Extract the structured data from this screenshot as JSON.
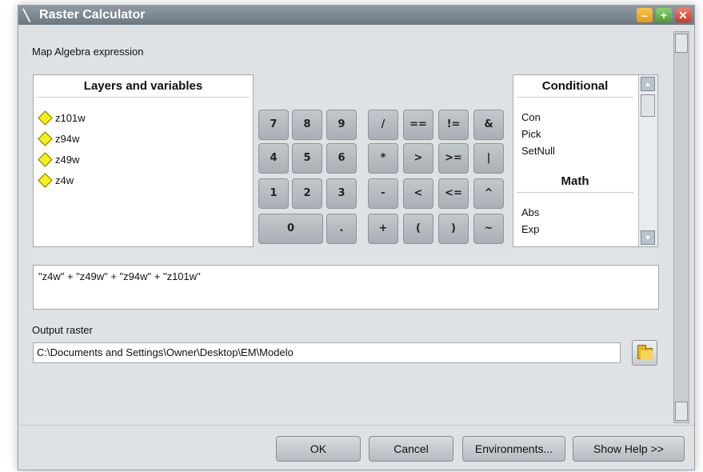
{
  "window": {
    "title": "Raster Calculator",
    "controls": {
      "minimize": "–",
      "maximize": "+",
      "close": "✕"
    },
    "icon": "raster-calculator-icon"
  },
  "expression_label": "Map Algebra expression",
  "layers": {
    "header": "Layers and variables",
    "items": [
      "z101w",
      "z94w",
      "z49w",
      "z4w"
    ]
  },
  "keypad": {
    "numbers": [
      "7",
      "8",
      "9",
      "4",
      "5",
      "6",
      "1",
      "2",
      "3",
      "0",
      "."
    ],
    "operators": [
      "/",
      "==",
      "!=",
      "&",
      "*",
      ">",
      ">=",
      "|",
      "-",
      "<",
      "<=",
      "^",
      "+",
      "(",
      ")",
      "~"
    ]
  },
  "functions": {
    "sections": [
      {
        "header": "Conditional",
        "items": [
          "Con",
          "Pick",
          "SetNull"
        ]
      },
      {
        "header": "Math",
        "items": [
          "Abs",
          "Exp"
        ]
      }
    ]
  },
  "expression": "\"z4w\" + \"z49w\" + \"z94w\" + \"z101w\"",
  "output": {
    "label": "Output raster",
    "value": "C:\\Documents and Settings\\Owner\\Desktop\\EM\\Modelo"
  },
  "buttons": {
    "ok": "OK",
    "cancel": "Cancel",
    "environments": "Environments...",
    "help": "Show Help >>"
  }
}
